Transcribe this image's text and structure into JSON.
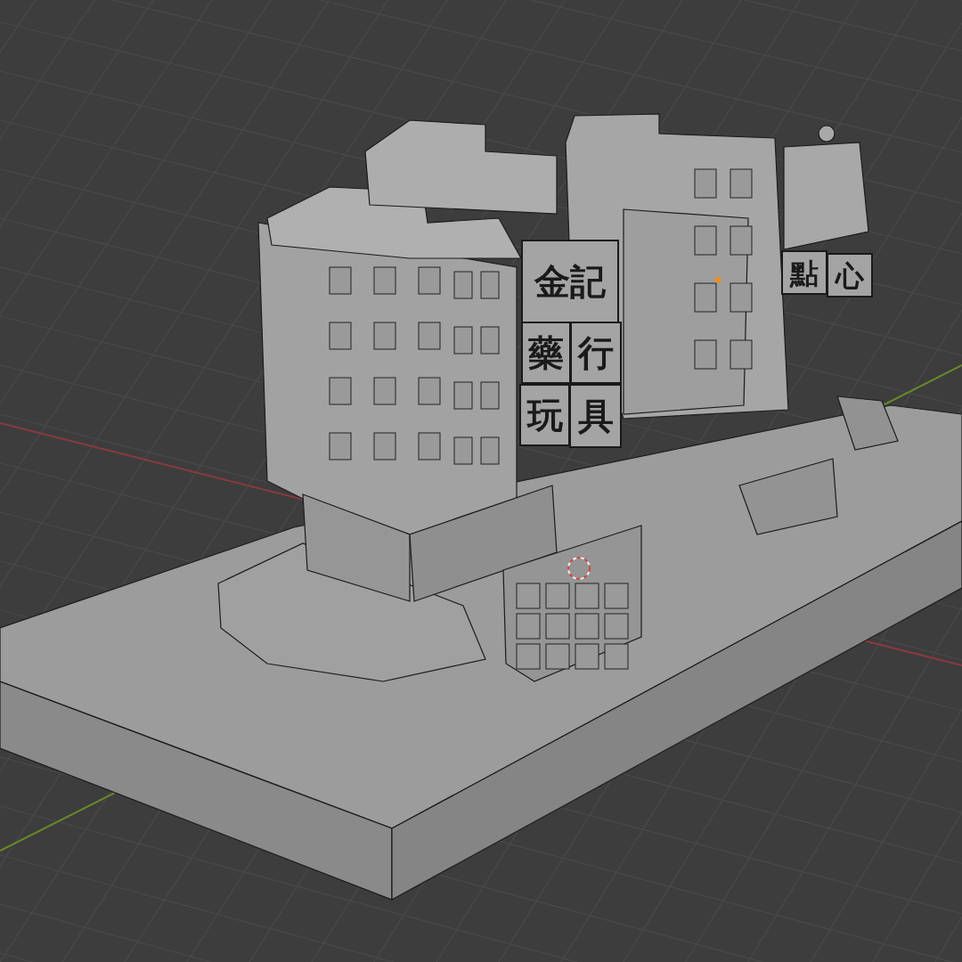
{
  "viewport": {
    "signs": [
      {
        "text": "金記"
      },
      {
        "text": "藥"
      },
      {
        "text": "行"
      },
      {
        "text": "玩"
      },
      {
        "text": "具"
      },
      {
        "text": "點"
      },
      {
        "text": "心"
      }
    ]
  }
}
